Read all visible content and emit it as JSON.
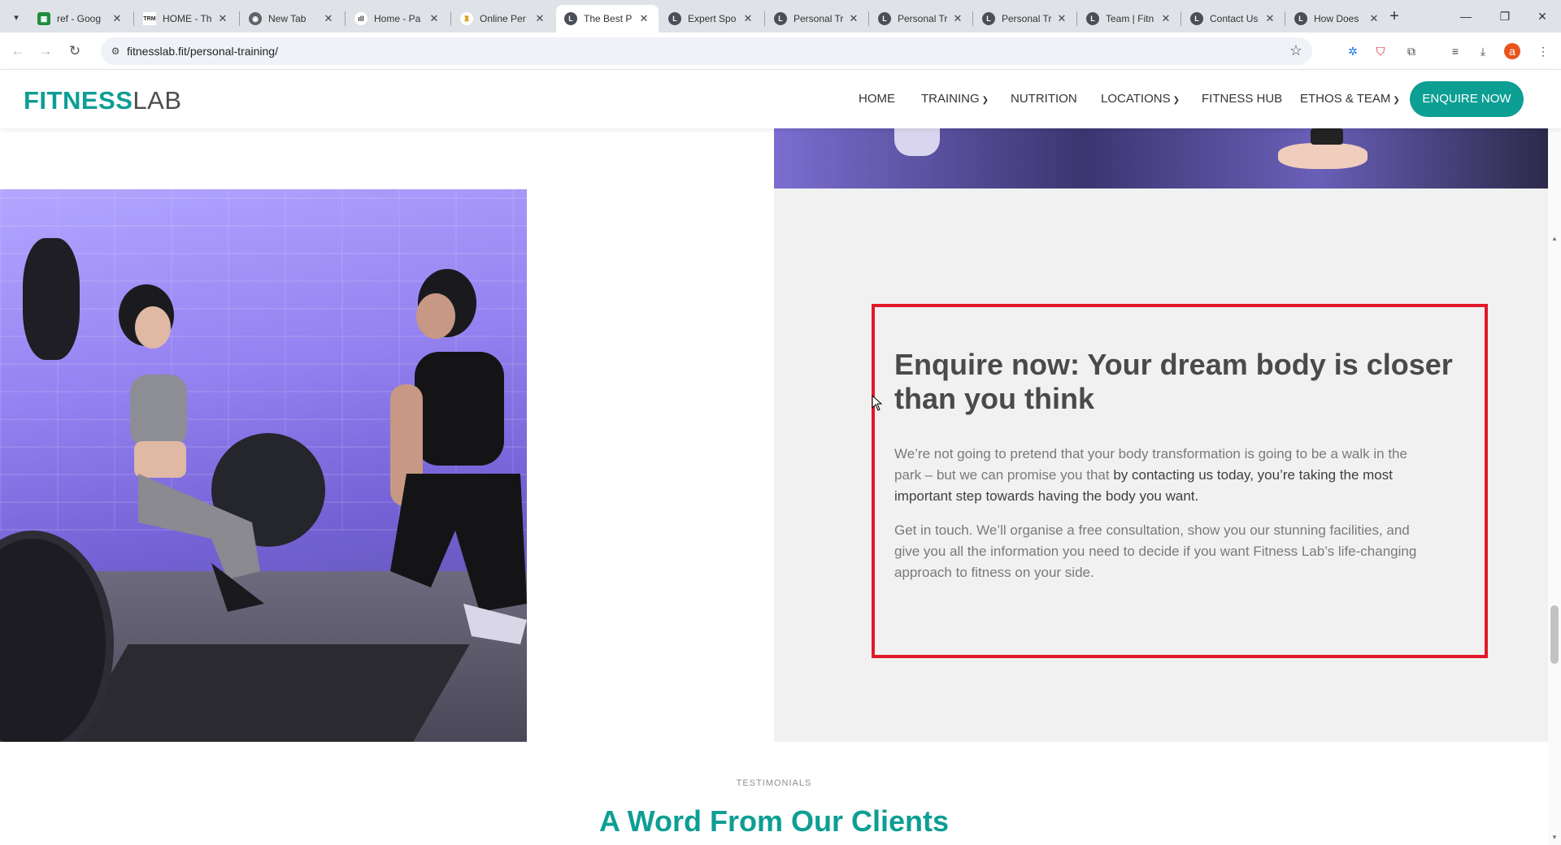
{
  "browser": {
    "tabs": [
      {
        "title": "ref - Goog",
        "favicon": "sheets-icon",
        "color": "#1e8e3e"
      },
      {
        "title": "HOME - Th",
        "favicon": "trm-icon",
        "color": "#222222"
      },
      {
        "title": "New Tab",
        "favicon": "chrome-icon",
        "color": "#5f6368"
      },
      {
        "title": "Home - Pa",
        "favicon": "bars-icon",
        "color": "#333333"
      },
      {
        "title": "Online Per",
        "favicon": "figure-icon",
        "color": "#d4a017"
      },
      {
        "title": "The Best P",
        "favicon": "fitnesslab-icon",
        "color": "#4a4f57"
      },
      {
        "title": "Expert Spo",
        "favicon": "fitnesslab-icon",
        "color": "#4a4f57"
      },
      {
        "title": "Personal Tr",
        "favicon": "fitnesslab-icon",
        "color": "#4a4f57"
      },
      {
        "title": "Personal Tr",
        "favicon": "fitnesslab-icon",
        "color": "#4a4f57"
      },
      {
        "title": "Personal Tr",
        "favicon": "fitnesslab-icon",
        "color": "#4a4f57"
      },
      {
        "title": "Team | Fitn",
        "favicon": "fitnesslab-icon",
        "color": "#4a4f57"
      },
      {
        "title": "Contact Us",
        "favicon": "fitnesslab-icon",
        "color": "#4a4f57"
      },
      {
        "title": "How Does",
        "favicon": "fitnesslab-icon",
        "color": "#4a4f57"
      }
    ],
    "active_tab_index": 5,
    "url": "fitnesslab.fit/personal-training/",
    "profile_initial": "a"
  },
  "site": {
    "logo_bold": "FITNESS",
    "logo_light": "LAB",
    "brand_color": "#0d9e94",
    "nav": [
      {
        "label": "HOME",
        "has_dropdown": false
      },
      {
        "label": "TRAINING",
        "has_dropdown": true
      },
      {
        "label": "NUTRITION",
        "has_dropdown": false
      },
      {
        "label": "LOCATIONS",
        "has_dropdown": true
      },
      {
        "label": "FITNESS HUB",
        "has_dropdown": false
      },
      {
        "label": "ETHOS & TEAM",
        "has_dropdown": true
      }
    ],
    "cta_button": "ENQUIRE NOW"
  },
  "enquire_section": {
    "title": "Enquire now: Your dream body is closer than you think",
    "p1_start": "We’re not going to pretend that your body transformation is going to be a walk in the park – but we can promise you that ",
    "p1_strong": "by contacting us today, you’re taking the most important step towards having the body you want.",
    "p2": "Get in touch. We’ll organise a free consultation, show you our stunning facilities, and give you all the information you need to decide if you want Fitness Lab’s life-changing approach to fitness on your side.",
    "highlight_color": "#e3182a"
  },
  "testimonials": {
    "label": "TESTIMONIALS",
    "title": "A Word From Our Clients"
  }
}
